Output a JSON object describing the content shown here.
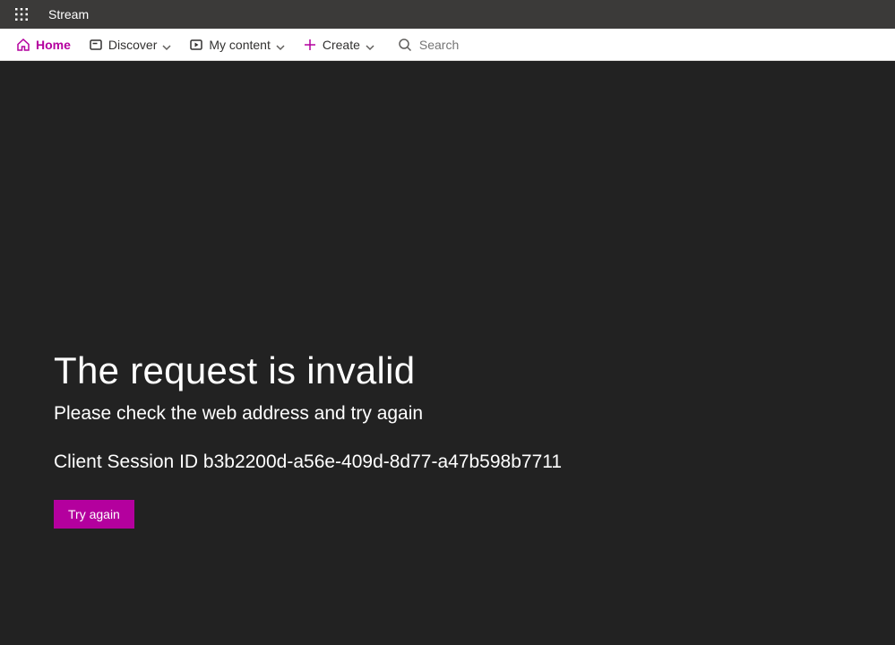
{
  "header": {
    "app_name": "Stream"
  },
  "nav": {
    "home": "Home",
    "discover": "Discover",
    "my_content": "My content",
    "create": "Create",
    "search_placeholder": "Search"
  },
  "error": {
    "title": "The request is invalid",
    "subtitle": "Please check the web address and try again",
    "session_label": "Client Session ID b3b2200d-a56e-409d-8d77-a47b598b7711",
    "retry_label": "Try again"
  },
  "colors": {
    "accent": "#b4009e",
    "topbar": "#3b3a39",
    "background": "#222222"
  }
}
